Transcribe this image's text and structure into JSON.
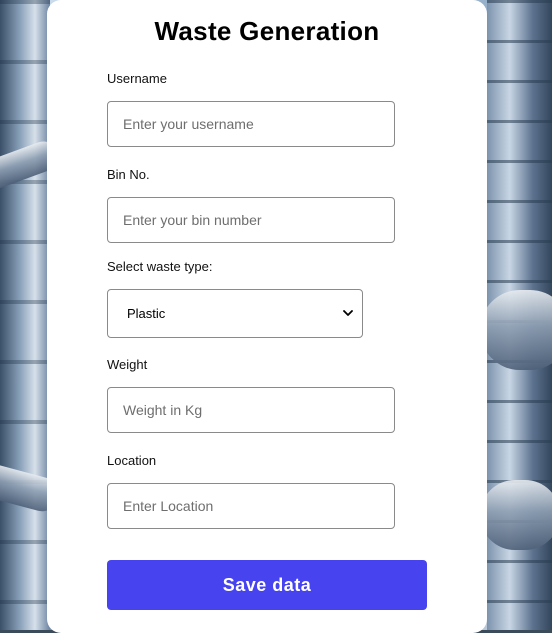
{
  "form": {
    "title": "Waste Generation",
    "username": {
      "label": "Username",
      "placeholder": "Enter your username",
      "value": ""
    },
    "bin_no": {
      "label": "Bin No.",
      "placeholder": "Enter your bin number",
      "value": ""
    },
    "waste_type": {
      "label": "Select waste type:",
      "selected": "Plastic"
    },
    "weight": {
      "label": "Weight",
      "placeholder": "Weight in Kg",
      "value": ""
    },
    "location": {
      "label": "Location",
      "placeholder": "Enter Location",
      "value": ""
    },
    "save_label": "Save data"
  },
  "colors": {
    "accent": "#4743ef",
    "card_background": "#ffffff",
    "input_border": "#8a8a8a"
  },
  "icons": {
    "select_arrow": "chevron-down-icon"
  }
}
